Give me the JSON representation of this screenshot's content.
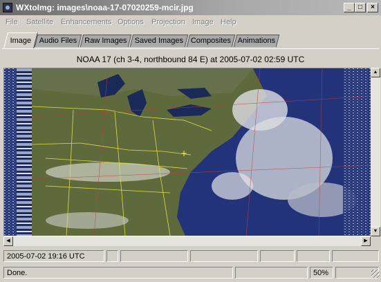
{
  "window": {
    "title": "WXtoImg: images\\noaa-17-07020259-mcir.jpg"
  },
  "menu": [
    "File",
    "Satellite",
    "Enhancements",
    "Options",
    "Projection",
    "Image",
    "Help"
  ],
  "tabs": [
    "Image",
    "Audio Files",
    "Raw Images",
    "Saved Images",
    "Composites",
    "Animations"
  ],
  "active_tab": "Image",
  "image": {
    "title": "NOAA 17 (ch 3-4, northbound 84 E) at 2005-07-02  02:59 UTC"
  },
  "status": {
    "timestamp": "2005-07-02  19:16 UTC",
    "message": "Done.",
    "zoom": "50%"
  },
  "icons": [
    "app-icon",
    "minimize-icon",
    "maximize-icon",
    "close-icon",
    "arrow-up-icon",
    "arrow-down-icon",
    "arrow-left-icon",
    "arrow-right-icon",
    "resize-grip-icon"
  ]
}
